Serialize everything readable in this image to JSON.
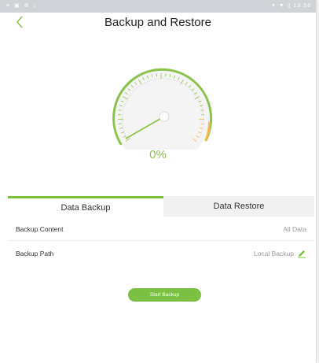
{
  "statusbar": {
    "left_icons": "≡ ▣ ⊕ ↕",
    "right_icons": "✶ ▼ ▯ 13:58"
  },
  "header": {
    "back_icon": "chevron-left-icon",
    "title": "Backup and Restore"
  },
  "gauge": {
    "progress_percent": 0,
    "label": "0%",
    "arc_color": "#8bc34a",
    "end_color": "#f5b942"
  },
  "tabs": [
    {
      "label": "Data Backup",
      "active": true
    },
    {
      "label": "Data Restore",
      "active": false
    }
  ],
  "rows": [
    {
      "label": "Backup Content",
      "value": "All Data"
    },
    {
      "label": "Backup Path",
      "value": "Local Backup",
      "icon": "pencil-edit-icon"
    }
  ],
  "actions": {
    "start_label": "Start Backup"
  },
  "colors": {
    "accent": "#7bc043",
    "tab_inactive_bg": "#f1f1f1"
  }
}
